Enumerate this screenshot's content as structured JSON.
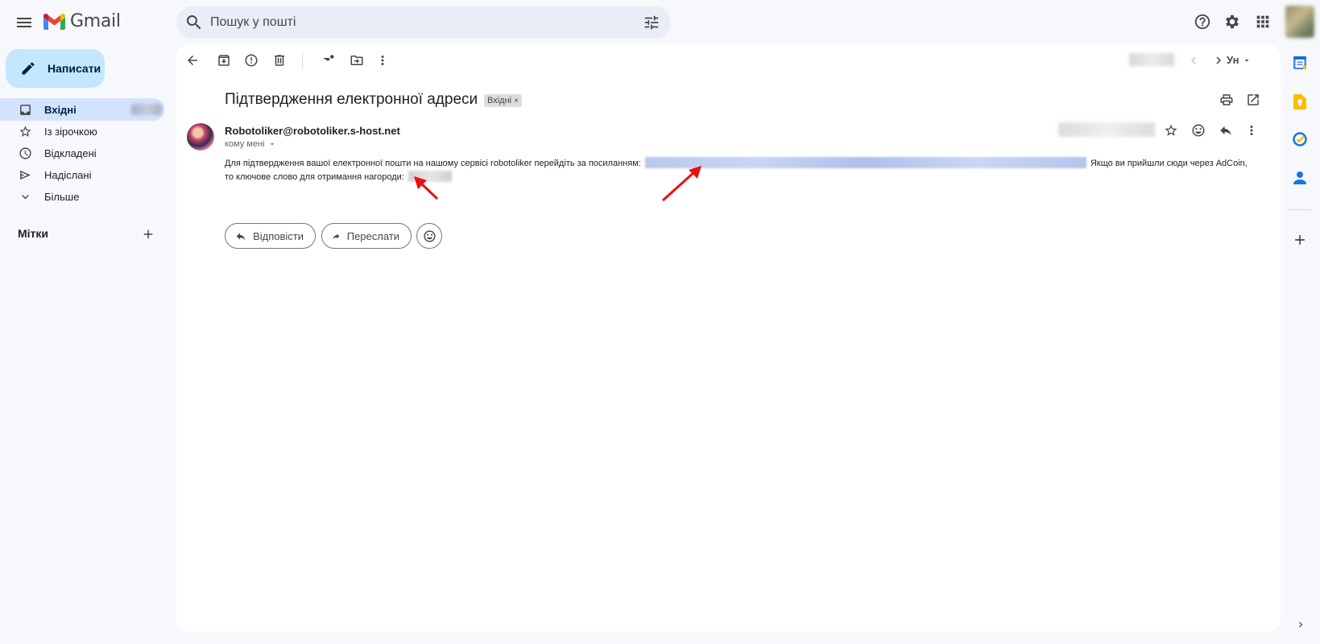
{
  "app": {
    "title": "Gmail"
  },
  "search": {
    "placeholder": "Пошук у пошті"
  },
  "sidebar": {
    "compose_label": "Написати",
    "items": [
      {
        "label": "Вхідні",
        "icon": "inbox-icon",
        "active": true
      },
      {
        "label": "Із зірочкою",
        "icon": "star-icon"
      },
      {
        "label": "Відкладені",
        "icon": "clock-icon"
      },
      {
        "label": "Надіслані",
        "icon": "send-icon"
      },
      {
        "label": "Більше",
        "icon": "chevron-down-icon"
      }
    ],
    "labels_title": "Мітки"
  },
  "toolbar": {
    "language_label": "Ун"
  },
  "message": {
    "subject": "Підтвердження електронної адреси",
    "chip_label": "Вхідні",
    "chip_close": "×",
    "sender": "Robotoliker@robotoliker.s-host.net",
    "to_label": "кому мені",
    "body_part1": "Для підтвердження вашої електронної пошти на нашому сервісі robotoliker перейдіть за посиланням:",
    "body_part2": "Якщо ви прийшли сюди через AdCoin,",
    "body_part3": "то ключове слово для отримання нагороди:"
  },
  "actions": {
    "reply_label": "Відповісти",
    "forward_label": "Переслати"
  },
  "colors": {
    "background": "#f6f8fc",
    "compose": "#c2e7ff",
    "active_nav": "#d3e3fd",
    "search_bg": "#e9eef6",
    "annotation_arrow": "#e8110f"
  }
}
